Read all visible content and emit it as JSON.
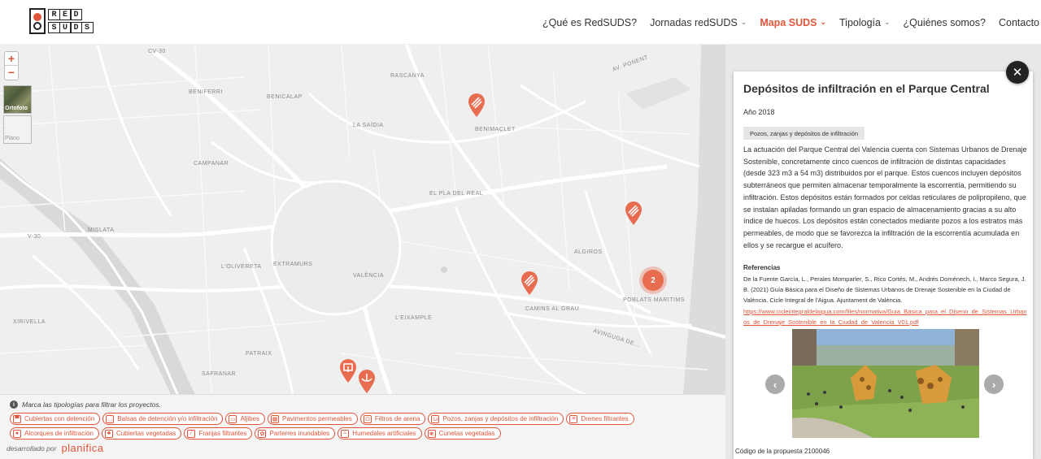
{
  "header": {
    "logo_top": [
      "R",
      "E",
      "D"
    ],
    "logo_bottom": [
      "S",
      "U",
      "D",
      "S"
    ],
    "nav": [
      {
        "label": "¿Qué es RedSUDS?",
        "dropdown": false,
        "active": false
      },
      {
        "label": "Jornadas redSUDS",
        "dropdown": true,
        "active": false
      },
      {
        "label": "Mapa SUDS",
        "dropdown": true,
        "active": true
      },
      {
        "label": "Tipología",
        "dropdown": true,
        "active": false
      },
      {
        "label": "¿Quiénes somos?",
        "dropdown": false,
        "active": false
      },
      {
        "label": "Contacto",
        "dropdown": false,
        "active": false
      }
    ]
  },
  "map": {
    "zoom_in": "+",
    "zoom_out": "−",
    "layers": {
      "ortofoto": "Ortofoto",
      "plano": "Plano"
    },
    "labels": {
      "cv30_top": "CV-30",
      "rascanya": "RASCANYA",
      "benifeiri": "BENIFERRI",
      "benicalap": "BENICALAP",
      "la_saidia": "LA SAÏDIA",
      "benimaclet": "BENIMACLET",
      "campanar": "CAMPANAR",
      "el_pla_del_real": "EL PLA DEL REAL",
      "mislata": "MISLATA",
      "v30": "V-30",
      "extramurs": "EXTRAMURS",
      "lolivereta": "L'OLIVERETA",
      "valencia": "VALÈNCIA",
      "algiros": "ALGIROS",
      "camins": "CAMINS AL GRAU",
      "poblats": "POBLATS MARITIMS",
      "xirivella": "XIRIVELLA",
      "leixample": "L'EIXAMPLE",
      "patraix": "PATRAIX",
      "safranar": "SAFRANAR",
      "av_ponent": "AV. PONENT",
      "av_tarongers": "AVINGUDA DE..."
    },
    "cluster_count": "2"
  },
  "legend": {
    "hint": "Marca las tipologías para filtrar los proyectos.",
    "row1": [
      {
        "icon": "roof-detention-icon",
        "glyph": "▀",
        "label": "Cubiertas con detención"
      },
      {
        "icon": "basin-icon",
        "glyph": "◡",
        "label": "Balsas de detención y/o infiltración"
      },
      {
        "icon": "cistern-icon",
        "glyph": "▭",
        "label": "Aljibes"
      },
      {
        "icon": "permeable-pavement-icon",
        "glyph": "▦",
        "label": "Pavimentos permeables"
      },
      {
        "icon": "sand-filter-icon",
        "glyph": "⊡",
        "label": "Filtros de arena"
      },
      {
        "icon": "infiltration-well-icon",
        "glyph": "⊔",
        "label": "Pozos, zanjas y depósitos de infiltración"
      },
      {
        "icon": "filter-drain-icon",
        "glyph": "≡",
        "label": "Drenes filtrantes"
      }
    ],
    "row2": [
      {
        "icon": "tree-pit-icon",
        "glyph": "●",
        "label": "Alcorques de infiltración"
      },
      {
        "icon": "green-roof-icon",
        "glyph": "♣",
        "label": "Cubiertas vegetadas"
      },
      {
        "icon": "filter-strip-icon",
        "glyph": "⁄",
        "label": "Franjas filtrantes"
      },
      {
        "icon": "rain-garden-icon",
        "glyph": "✿",
        "label": "Parterres inundables"
      },
      {
        "icon": "wetland-icon",
        "glyph": "≈",
        "label": "Humedales artificiales"
      },
      {
        "icon": "swale-icon",
        "glyph": "❀",
        "label": "Cunetas vegetadas"
      }
    ],
    "credit_prefix": "desarrollado por",
    "credit_brand": "planifica"
  },
  "panel": {
    "close": "✕",
    "title": "Depósitos de infiltración en el Parque Central",
    "year": "Año 2018",
    "tag": "Pozos, zanjas y depósitos de infiltración",
    "description": "La actuación del Parque Central del Valencia cuenta con Sistemas Urbanos de Drenaje Sostenible, concretamente cinco cuencos de infiltración de distintas capacidades (desde 323 m3 a 54 m3) distribuidos por el parque. Estos cuencos incluyen depósitos subterráneos que permiten almacenar temporalmente la escorrentía, permitiendo su infiltración. Estos depósitos están formados por celdas reticulares de polipropileno, que se instalan apiladas formando un gran espacio de almacenamiento gracias a su alto índice de huecos. Los depósitos están conectados mediante pozos a los estratos más permeables, de modo que se favorezca la infiltración de la escorrentía acumulada en ellos y se recargue el acuífero.",
    "ref_title": "Referencias",
    "ref_text": "De la Fuente García, L., Perales Momparler, S., Rico Cortés, M., Andrés Doménech, I., Marco Segura, J. B. (2021) Guía Básica para el Diseño de Sistemas Urbanos de Drenaje Sostenible en la Ciudad de València. Cicle Integral de l'Aigua. Ajuntament de València.",
    "ref_link": "https://www.cicleintegraldelaigua.com/files/normativa/Guia_Basica_para_el_Diseno_de_Sistemas_Urbanos_de_Drenaje_Sostenible_en_la_Ciudad_de_Valencia_V01.pdf",
    "prev": "‹",
    "next": "›",
    "code": "Código de la propuesta 2100046"
  },
  "colors": {
    "accent": "#e0553a",
    "marker": "#e86c50"
  }
}
